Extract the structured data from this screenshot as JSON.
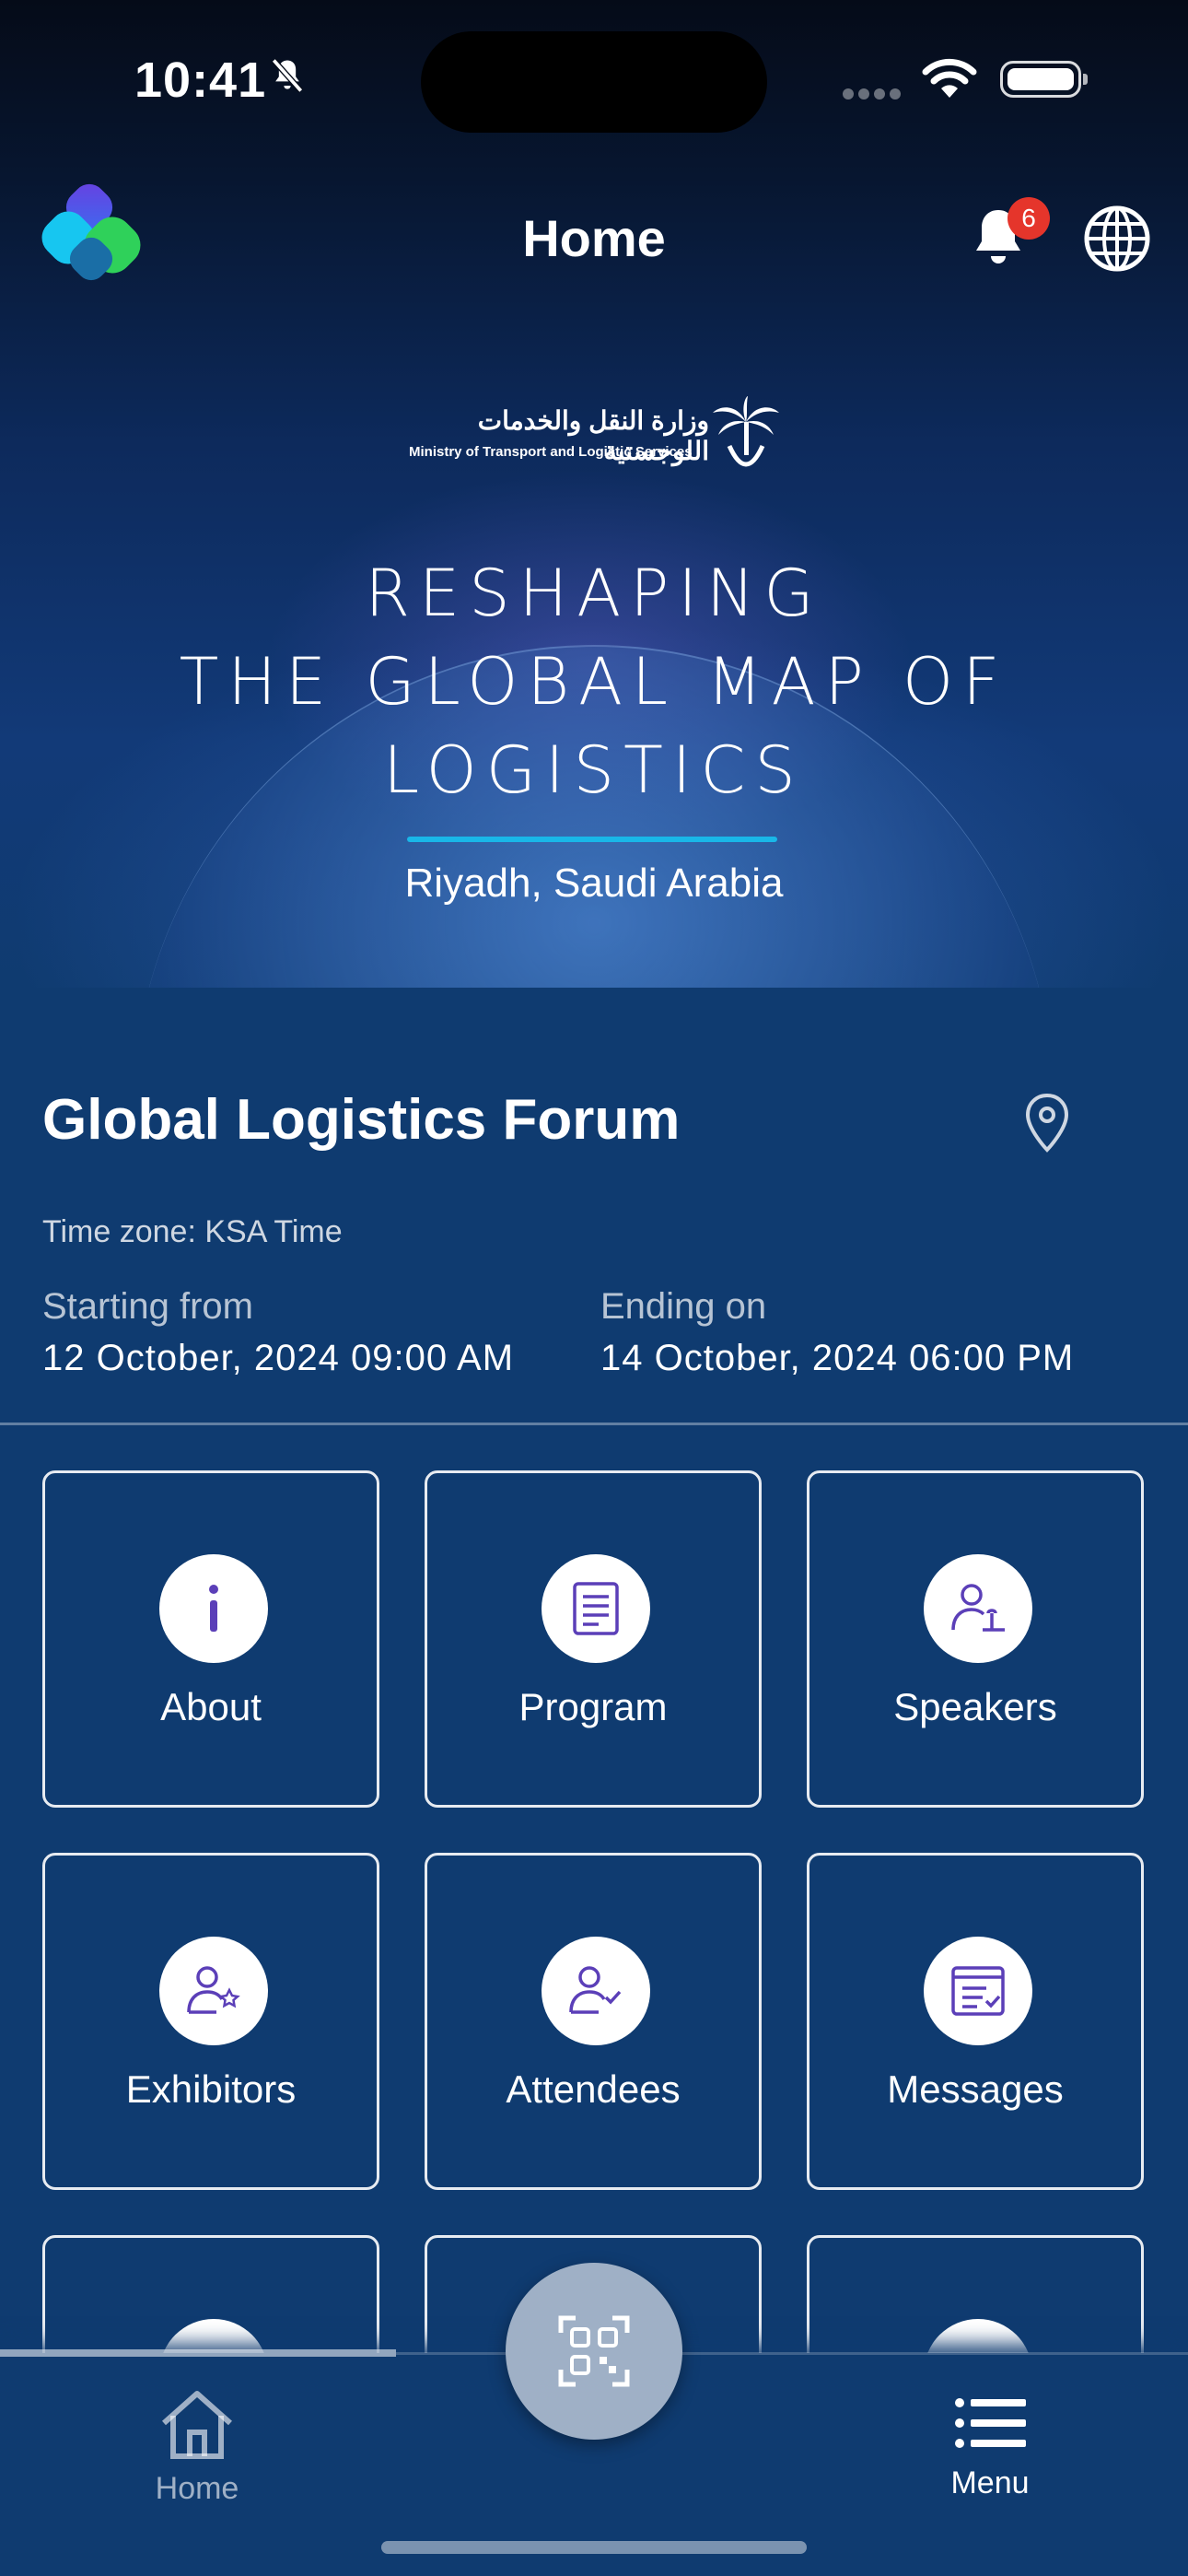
{
  "status_bar": {
    "time": "10:41"
  },
  "header": {
    "title": "Home",
    "notification_count": "6"
  },
  "banner": {
    "ministry_arabic": "وزارة النقل والخدمات اللوجستية",
    "ministry_english": "Ministry of Transport and Logistic Services",
    "headline_lines": [
      "RESHAPING",
      "THE GLOBAL MAP OF",
      "LOGISTICS"
    ],
    "location": "Riyadh, Saudi Arabia",
    "accent_color": "#19b7e8"
  },
  "event": {
    "title": "Global Logistics Forum",
    "timezone": "Time zone: KSA Time",
    "start_label": "Starting from",
    "start_value": "12 October, 2024   09:00 AM",
    "end_label": "Ending on",
    "end_value": "14 October, 2024   06:00 PM"
  },
  "tiles": [
    {
      "label": "About",
      "icon": "info-icon"
    },
    {
      "label": "Program",
      "icon": "document-icon"
    },
    {
      "label": "Speakers",
      "icon": "speaker-icon"
    },
    {
      "label": "Exhibitors",
      "icon": "exhibitor-icon"
    },
    {
      "label": "Attendees",
      "icon": "attendee-icon"
    },
    {
      "label": "Messages",
      "icon": "messages-icon"
    }
  ],
  "bottom_nav": {
    "home_label": "Home",
    "menu_label": "Menu",
    "fab_icon": "qr-code-icon"
  }
}
